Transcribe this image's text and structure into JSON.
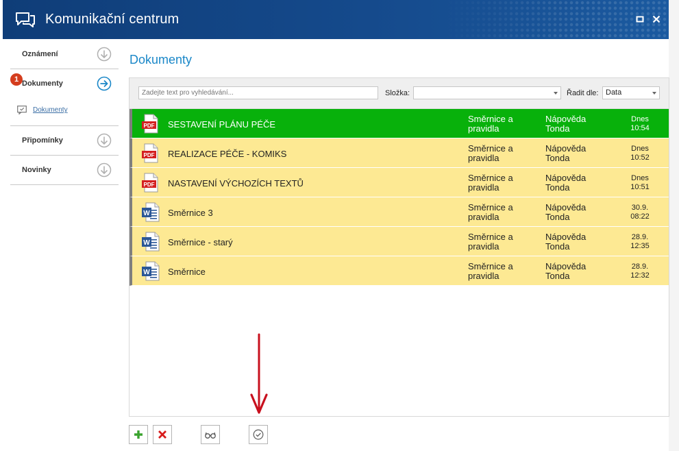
{
  "window": {
    "title": "Komunikační centrum",
    "icon": "chat-bubbles-icon",
    "buttons": [
      "maximize-icon",
      "close-icon"
    ]
  },
  "sidebar": {
    "items": [
      {
        "label": "Oznámení",
        "icon": "arrow-down-circle-icon"
      },
      {
        "label": "Dokumenty",
        "badge": "1",
        "icon": "arrow-right-circle-icon",
        "active": true
      },
      {
        "label": "Dokumenty",
        "icon": "document-chat-icon",
        "sub": true
      },
      {
        "label": "Připomínky",
        "icon": "arrow-down-circle-icon"
      },
      {
        "label": "Novinky",
        "icon": "arrow-down-circle-icon"
      }
    ]
  },
  "main": {
    "title": "Dokumenty",
    "search": {
      "placeholder": "Zadejte text pro vyhledávání...",
      "value": ""
    },
    "folder": {
      "label": "Složka:",
      "value": ""
    },
    "sort": {
      "label": "Řadit dle:",
      "value": "Data"
    },
    "documents": [
      {
        "type": "pdf",
        "title": "SESTAVENÍ PLÁNU PÉČE",
        "category_line1": "Směrnice a",
        "category_line2": "pravidla",
        "author_line1": "Nápověda",
        "author_line2": "Tonda",
        "date_line1": "Dnes",
        "date_line2": "10:54",
        "selected": true
      },
      {
        "type": "pdf",
        "title": "REALIZACE PÉČE - KOMIKS",
        "category_line1": "Směrnice a",
        "category_line2": "pravidla",
        "author_line1": "Nápověda",
        "author_line2": "Tonda",
        "date_line1": "Dnes",
        "date_line2": "10:52"
      },
      {
        "type": "pdf",
        "title": "NASTAVENÍ VÝCHOZÍCH TEXTŮ",
        "category_line1": "Směrnice a",
        "category_line2": "pravidla",
        "author_line1": "Nápověda",
        "author_line2": "Tonda",
        "date_line1": "Dnes",
        "date_line2": "10:51"
      },
      {
        "type": "word",
        "title": "Směrnice 3",
        "category_line1": "Směrnice a",
        "category_line2": "pravidla",
        "author_line1": "Nápověda",
        "author_line2": "Tonda",
        "date_line1": "30.9.",
        "date_line2": "08:22"
      },
      {
        "type": "word",
        "title": "Směrnice - starý",
        "category_line1": "Směrnice a",
        "category_line2": "pravidla",
        "author_line1": "Nápověda",
        "author_line2": "Tonda",
        "date_line1": "28.9.",
        "date_line2": "12:35"
      },
      {
        "type": "word",
        "title": "Směrnice",
        "category_line1": "Směrnice a",
        "category_line2": "pravidla",
        "author_line1": "Nápověda",
        "author_line2": "Tonda",
        "date_line1": "28.9.",
        "date_line2": "12:32"
      }
    ]
  },
  "bottom_buttons": [
    "plus-icon",
    "delete-x-icon",
    "glasses-icon",
    "check-circle-icon"
  ],
  "colors": {
    "titlebar": "#154a8c",
    "accent": "#1a87c8",
    "row_selected": "#08b10b",
    "row_default": "#fde993",
    "badge": "#d43d1e",
    "arrow_annotation": "#c8101e"
  }
}
